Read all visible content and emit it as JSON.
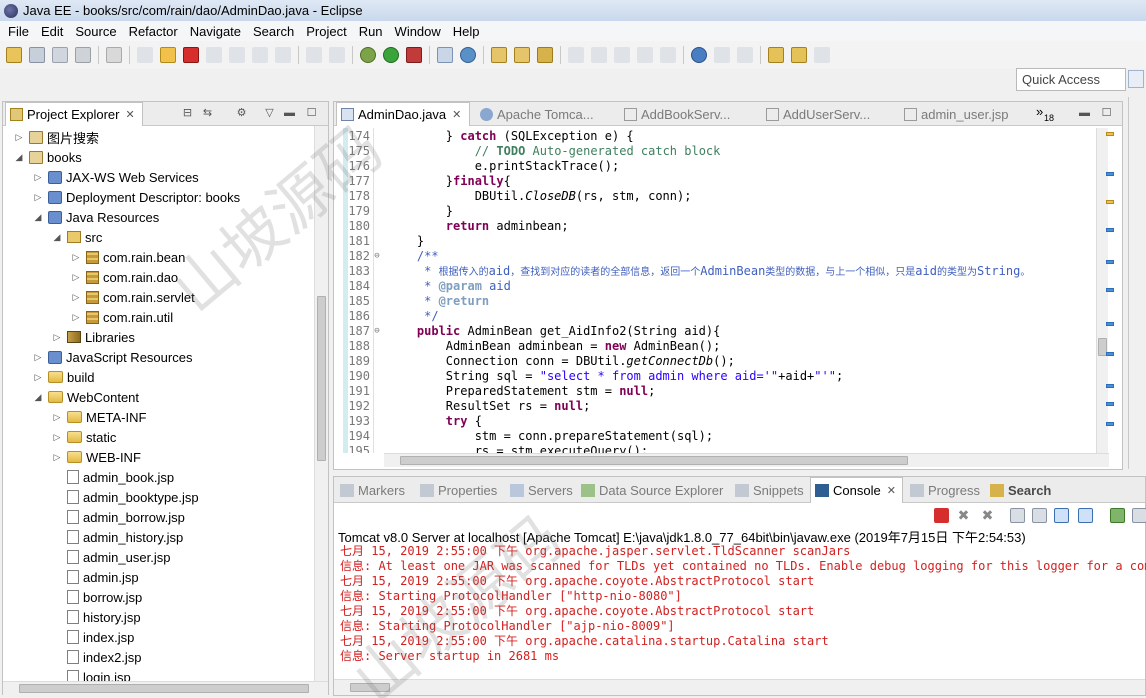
{
  "window": {
    "title": "Java EE - books/src/com/rain/dao/AdminDao.java - Eclipse"
  },
  "menu": [
    "File",
    "Edit",
    "Source",
    "Refactor",
    "Navigate",
    "Search",
    "Project",
    "Run",
    "Window",
    "Help"
  ],
  "quick_access": {
    "placeholder": "Quick Access"
  },
  "explorer": {
    "tab_label": "Project Explorer",
    "nodes": [
      {
        "label": "图片搜索",
        "icon": "project-icon",
        "twisty": "▷"
      },
      {
        "label": "books",
        "icon": "project-icon",
        "twisty": "◢"
      },
      {
        "label": "JAX-WS Web Services",
        "icon": "webservice-icon",
        "twisty": "▷"
      },
      {
        "label": "Deployment Descriptor: books",
        "icon": "descriptor-icon",
        "twisty": "▷"
      },
      {
        "label": "Java Resources",
        "icon": "java-resources-icon",
        "twisty": "◢"
      },
      {
        "label": "src",
        "icon": "source-folder-icon",
        "twisty": "◢"
      },
      {
        "label": "com.rain.bean",
        "icon": "package-icon",
        "twisty": "▷"
      },
      {
        "label": "com.rain.dao",
        "icon": "package-icon",
        "twisty": "▷"
      },
      {
        "label": "com.rain.servlet",
        "icon": "package-icon",
        "twisty": "▷"
      },
      {
        "label": "com.rain.util",
        "icon": "package-icon",
        "twisty": "▷"
      },
      {
        "label": "Libraries",
        "icon": "library-icon",
        "twisty": "▷"
      },
      {
        "label": "JavaScript Resources",
        "icon": "js-resources-icon",
        "twisty": "▷"
      },
      {
        "label": "build",
        "icon": "folder-icon",
        "twisty": "▷"
      },
      {
        "label": "WebContent",
        "icon": "folder-icon",
        "twisty": "◢"
      },
      {
        "label": "META-INF",
        "icon": "folder-icon",
        "twisty": "▷"
      },
      {
        "label": "static",
        "icon": "folder-icon",
        "twisty": "▷"
      },
      {
        "label": "WEB-INF",
        "icon": "folder-icon",
        "twisty": "▷"
      },
      {
        "label": "admin_book.jsp",
        "icon": "jsp-file-icon",
        "twisty": ""
      },
      {
        "label": "admin_booktype.jsp",
        "icon": "jsp-file-icon",
        "twisty": ""
      },
      {
        "label": "admin_borrow.jsp",
        "icon": "jsp-file-icon",
        "twisty": ""
      },
      {
        "label": "admin_history.jsp",
        "icon": "jsp-file-icon",
        "twisty": ""
      },
      {
        "label": "admin_user.jsp",
        "icon": "jsp-file-icon",
        "twisty": ""
      },
      {
        "label": "admin.jsp",
        "icon": "jsp-file-icon",
        "twisty": ""
      },
      {
        "label": "borrow.jsp",
        "icon": "jsp-file-icon",
        "twisty": ""
      },
      {
        "label": "history.jsp",
        "icon": "jsp-file-icon",
        "twisty": ""
      },
      {
        "label": "index.jsp",
        "icon": "jsp-file-icon",
        "twisty": ""
      },
      {
        "label": "index2.jsp",
        "icon": "jsp-file-icon",
        "twisty": ""
      },
      {
        "label": "login.jsp",
        "icon": "jsp-file-icon",
        "twisty": ""
      }
    ]
  },
  "editor": {
    "tabs": [
      "AdminDao.java",
      "Apache Tomca...",
      "AddBookServ...",
      "AddUserServ...",
      "admin_user.jsp"
    ],
    "overflow": "»",
    "overflow_count": "18",
    "lines": [
      {
        "n": "174",
        "fold": "",
        "html": "        } <span class=\"kw\">catch</span> (SQLException e) {"
      },
      {
        "n": "175",
        "fold": "",
        "html": "            <span class=\"cm\">// <b>TODO</b> Auto-generated catch block</span>"
      },
      {
        "n": "176",
        "fold": "",
        "html": "            e.printStackTrace();"
      },
      {
        "n": "177",
        "fold": "",
        "html": "        }<span class=\"kw\">finally</span>{"
      },
      {
        "n": "178",
        "fold": "",
        "html": "            DBUtil.<span class=\"it\">CloseDB</span>(rs, stm, conn);"
      },
      {
        "n": "179",
        "fold": "",
        "html": "        }"
      },
      {
        "n": "180",
        "fold": "",
        "html": "        <span class=\"kw\">return</span> adminbean;"
      },
      {
        "n": "181",
        "fold": "",
        "html": "    }"
      },
      {
        "n": "182",
        "fold": "⊖",
        "html": "    <span class=\"jd\">/**</span>"
      },
      {
        "n": "183",
        "fold": "",
        "html": "<span class=\"jd\">     * <span style=\"font-size:10px\">根据传入的</span>aid<span style=\"font-size:10px\">，查找到对应的读者的全部信息，返回一个</span>AdminBean<span style=\"font-size:10px\">类型的数据，与上一个相似，只是</span>aid<span style=\"font-size:10px\">的类型为</span>String<span style=\"font-size:10px\">。</span></span>"
      },
      {
        "n": "184",
        "fold": "",
        "html": "<span class=\"jd\">     * <b style=\"color:#7f9fbf\">@param</b> aid</span>"
      },
      {
        "n": "185",
        "fold": "",
        "html": "<span class=\"jd\">     * <b style=\"color:#7f9fbf\">@return</b></span>"
      },
      {
        "n": "186",
        "fold": "",
        "html": "<span class=\"jd\">     */</span>"
      },
      {
        "n": "187",
        "fold": "⊖",
        "html": "    <span class=\"kw\">public</span> AdminBean get_AidInfo2(String aid){"
      },
      {
        "n": "188",
        "fold": "",
        "html": "        AdminBean adminbean = <span class=\"kw\">new</span> AdminBean();"
      },
      {
        "n": "189",
        "fold": "",
        "html": "        Connection conn = DBUtil.<span class=\"it\">getConnectDb</span>();"
      },
      {
        "n": "190",
        "fold": "",
        "html": "        String sql = <span class=\"st\">\"select * from admin where aid='\"</span>+aid+<span class=\"st\">\"'\"</span>;"
      },
      {
        "n": "191",
        "fold": "",
        "html": "        PreparedStatement stm = <span class=\"kw\">null</span>;"
      },
      {
        "n": "192",
        "fold": "",
        "html": "        ResultSet rs = <span class=\"kw\">null</span>;"
      },
      {
        "n": "193",
        "fold": "",
        "html": "        <span class=\"kw\">try</span> {"
      },
      {
        "n": "194",
        "fold": "",
        "html": "            stm = conn.prepareStatement(sql);"
      },
      {
        "n": "195",
        "fold": "",
        "html": "            rs = stm.executeQuery();"
      }
    ]
  },
  "console": {
    "tabs": [
      "Markers",
      "Properties",
      "Servers",
      "Data Source Explorer",
      "Snippets",
      "Console",
      "Progress",
      "Search"
    ],
    "active_tab": "Console",
    "header": "Tomcat v8.0 Server at localhost [Apache Tomcat] E:\\java\\jdk1.8.0_77_64bit\\bin\\javaw.exe (2019年7月15日 下午2:54:53)",
    "lines": [
      "七月 15, 2019 2:55:00 下午 org.apache.jasper.servlet.TldScanner scanJars",
      "信息: At least one JAR was scanned for TLDs yet contained no TLDs. Enable debug logging for this logger for a complete",
      "七月 15, 2019 2:55:00 下午 org.apache.coyote.AbstractProtocol start",
      "信息: Starting ProtocolHandler [\"http-nio-8080\"]",
      "七月 15, 2019 2:55:00 下午 org.apache.coyote.AbstractProtocol start",
      "信息: Starting ProtocolHandler [\"ajp-nio-8009\"]",
      "七月 15, 2019 2:55:00 下午 org.apache.catalina.startup.Catalina start",
      "信息: Server startup in 2681 ms"
    ]
  },
  "watermarks": [
    "山坡源码",
    "山坡源码"
  ]
}
